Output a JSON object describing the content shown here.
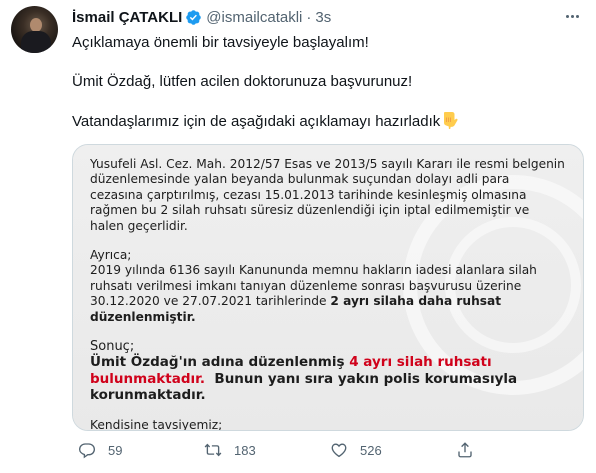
{
  "tweet": {
    "author_name": "İsmail ÇATAKLI",
    "handle": "@ismailcatakli",
    "separator": "·",
    "time": "3s",
    "lines": [
      "Açıklamaya önemli bir tavsiyeyle başlayalım!",
      "Ümit Özdağ, lütfen acilen doktorunuza başvurunuz!",
      "Vatandaşlarımız için de aşağıdaki açıklamayı hazırladık"
    ],
    "emoji_icon": "backhand-index-pointing-down"
  },
  "document": {
    "para1": [
      "Yusufeli Asl. Cez. Mah. 2012/57 Esas ve 2013/5 sayılı Kararı ile resmi belgenin",
      "düzenlemesinde yalan beyanda bulunmak suçundan dolayı adli para",
      "cezasına çarptırılmış, cezası 15.01.2013 tarihinde kesinleşmiş olmasına",
      "rağmen bu 2 silah ruhsatı süresiz düzenlendiği için iptal edilmemiştir ve",
      "halen geçerlidir."
    ],
    "ayrica": "Ayrıca;",
    "para2": [
      "2019 yılında 6136 sayılı Kanununda memnu hakların iadesi alanlara silah",
      "ruhsatı verilmesi imkanı tanıyan düzenleme sonrası başvurusu üzerine",
      "30.12.2020 ve 27.07.2021 tarihlerinde"
    ],
    "para2_bold": "2 ayrı silaha daha ruhsat",
    "para2_bold_line2": "düzenlenmiştir.",
    "sonuc": "Sonuç;",
    "result_line1_a": "Ümit Özdağ'ın adına düzenlenmiş",
    "result_line1_red": "4 ayrı silah ruhsatı",
    "result_line2_red": "bulunmaktadır.",
    "result_line2_b": "Bunun yanı sıra yakın polis korumasıyla",
    "result_line3": "korunmaktadır.",
    "kendisine": "Kendisine tavsiyemiz;"
  },
  "actions": {
    "reply_count": "59",
    "retweet_count": "183",
    "like_count": "526"
  },
  "colors": {
    "verified": "#1d9bf0",
    "red_text": "#d0021b",
    "muted": "#536471"
  }
}
